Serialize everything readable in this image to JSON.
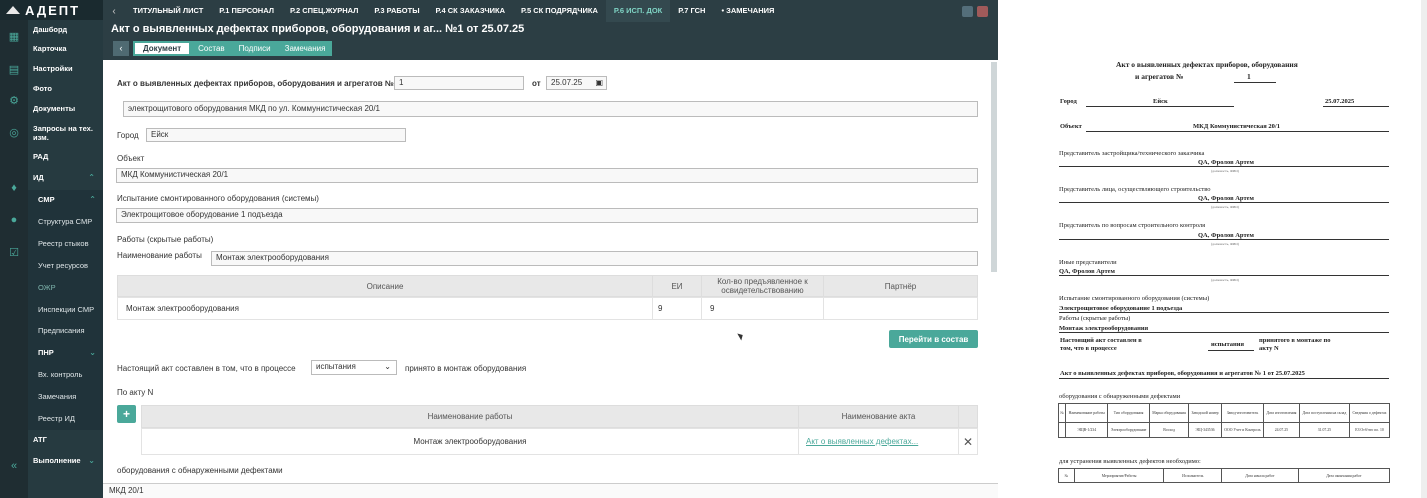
{
  "app": {
    "brand": "АДЕПТ"
  },
  "nav": {
    "dashboard": "Дашборд",
    "card": "Карточка",
    "settings": "Настройки",
    "photo": "Фото",
    "documents": "Документы",
    "requests": "Запросы на тех. изм.",
    "rad": "РАД",
    "id": "ИД",
    "smr": "СМР",
    "smr_structure": "Структура СМР",
    "joints": "Реестр стыков",
    "resources": "Учет ресурсов",
    "ozhr": "ОЖР",
    "inspections": "Инспекции СМР",
    "prescriptions": "Предписания",
    "pnr": "ПНР",
    "control": "Вх. контроль",
    "remarks": "Замечания",
    "registry": "Реестр ИД",
    "atg": "АТГ",
    "execution": "Выполнение"
  },
  "topbar": {
    "tabs": [
      "ТИТУЛЬНЫЙ ЛИСТ",
      "Р.1 ПЕРСОНАЛ",
      "Р.2 СПЕЦ.ЖУРНАЛ",
      "Р.3 РАБОТЫ",
      "Р.4 СК ЗАКАЗЧИКА",
      "Р.5 СК ПОДРЯДЧИКА",
      "Р.6 ИСП. ДОК",
      "Р.7 ГСН",
      "• ЗАМЕЧАНИЯ"
    ]
  },
  "header": {
    "title": "Акт о выявленных дефектах приборов, оборудования и аг... №1 от 25.07.25",
    "subtabs": [
      "Документ",
      "Состав",
      "Подписи",
      "Замечания"
    ]
  },
  "form": {
    "act_label": "Акт о выявленных дефектах приборов, оборудования и агрегатов №",
    "act_number": "1",
    "from_label": "от",
    "date": "25.07.25",
    "subject": "электрощитового оборудования МКД по ул. Коммунистическая 20/1",
    "city_label": "Город",
    "city": "Ейск",
    "object_label": "Объект",
    "object": "МКД Коммунистическая 20/1",
    "test_label": "Испытание смонтированного оборудования (системы)",
    "test": "Электрощитовое оборудование 1 подъезда",
    "works_label": "Работы (скрытые работы)",
    "work_name_label": "Наименование работы",
    "work_name": "Монтаж электрооборудования",
    "table_headers": [
      "Описание",
      "ЕИ",
      "Кол-во предъявленное к освидетельствованию",
      "Партнёр"
    ],
    "table_row": {
      "desc": "Монтаж электрооборудования",
      "unit": "9",
      "qty": "9",
      "partner": ""
    },
    "goto_btn": "Перейти в состав",
    "process_label": "Настоящий акт составлен в том, что в процессе",
    "process_value": "испытания",
    "process_tail": "принято в монтаж оборудования",
    "act_n_label": "По акту N",
    "table2_headers": [
      "Наименование работы",
      "Наименование акта"
    ],
    "table2_row": {
      "work": "Монтаж электрооборудования",
      "act": "Акт о выявленных дефектах..."
    },
    "defects_label": "оборудования с обнаруженными дефектами"
  },
  "footer": {
    "text": "МКД 20/1"
  },
  "doc": {
    "title1": "Акт о выявленных дефектах приборов, оборудования",
    "title2": "и агрегатов №",
    "num": "1",
    "city_l": "Город",
    "city": "Ейск",
    "date": "25.07.2025",
    "obj_l": "Объект",
    "obj": "МКД Коммунистическая 20/1",
    "rep1": "Представитель застройщика/технического заказчика",
    "rep1v": "QA, Фролов Артем",
    "pos": "(должность, ФИО)",
    "rep2": "Представитель лица, осуществляющего строительство",
    "rep2v": "QA, Фролов Артем",
    "rep3": "Представитель по вопросам строительного контроля",
    "rep3v": "QA, Фролов Артем",
    "rep4": "Иные представители",
    "rep4v": "QA, Фролов Артем",
    "test_l": "Испытание смонтированного оборудования (системы)",
    "test": "Электрощитовое оборудование 1 подъезда",
    "works_l": "Работы (скрытые работы)",
    "works": "Монтаж электрооборудования",
    "proc1": "Настоящий акт составлен в том, что в процессе",
    "proc_v": "испытания",
    "proc2": "принятого в монтаже по акту N",
    "act_line": "Акт о выявленных дефектах приборов, оборудования и агрегатов № 1 от 25.07.2025",
    "defects": "оборудования с обнаруженными дефектами",
    "t_headers": [
      "№",
      "Наименование работы",
      "Тип оборудования",
      "Марка оборудования",
      "Заводской номер",
      "Завод-изготовитель",
      "Дата изготовления",
      "Дата поступления на склад",
      "Сведения о дефектах"
    ],
    "t_row": [
      "",
      "ЭЩВ-1/234",
      "Электрооборудование",
      "Восход",
      "ЭЩ-343536",
      "ООО Учет и Контроль",
      "24.07.25",
      "31.07.25",
      "ЕЗ Отб/что по. 10"
    ],
    "fix_l": "для устранения выявленных дефектов необходимо:",
    "t2_headers": [
      "№",
      "Мероприятие/Работы",
      "Исполнитель",
      "Дата начала работ",
      "Дата окончания работ"
    ]
  }
}
